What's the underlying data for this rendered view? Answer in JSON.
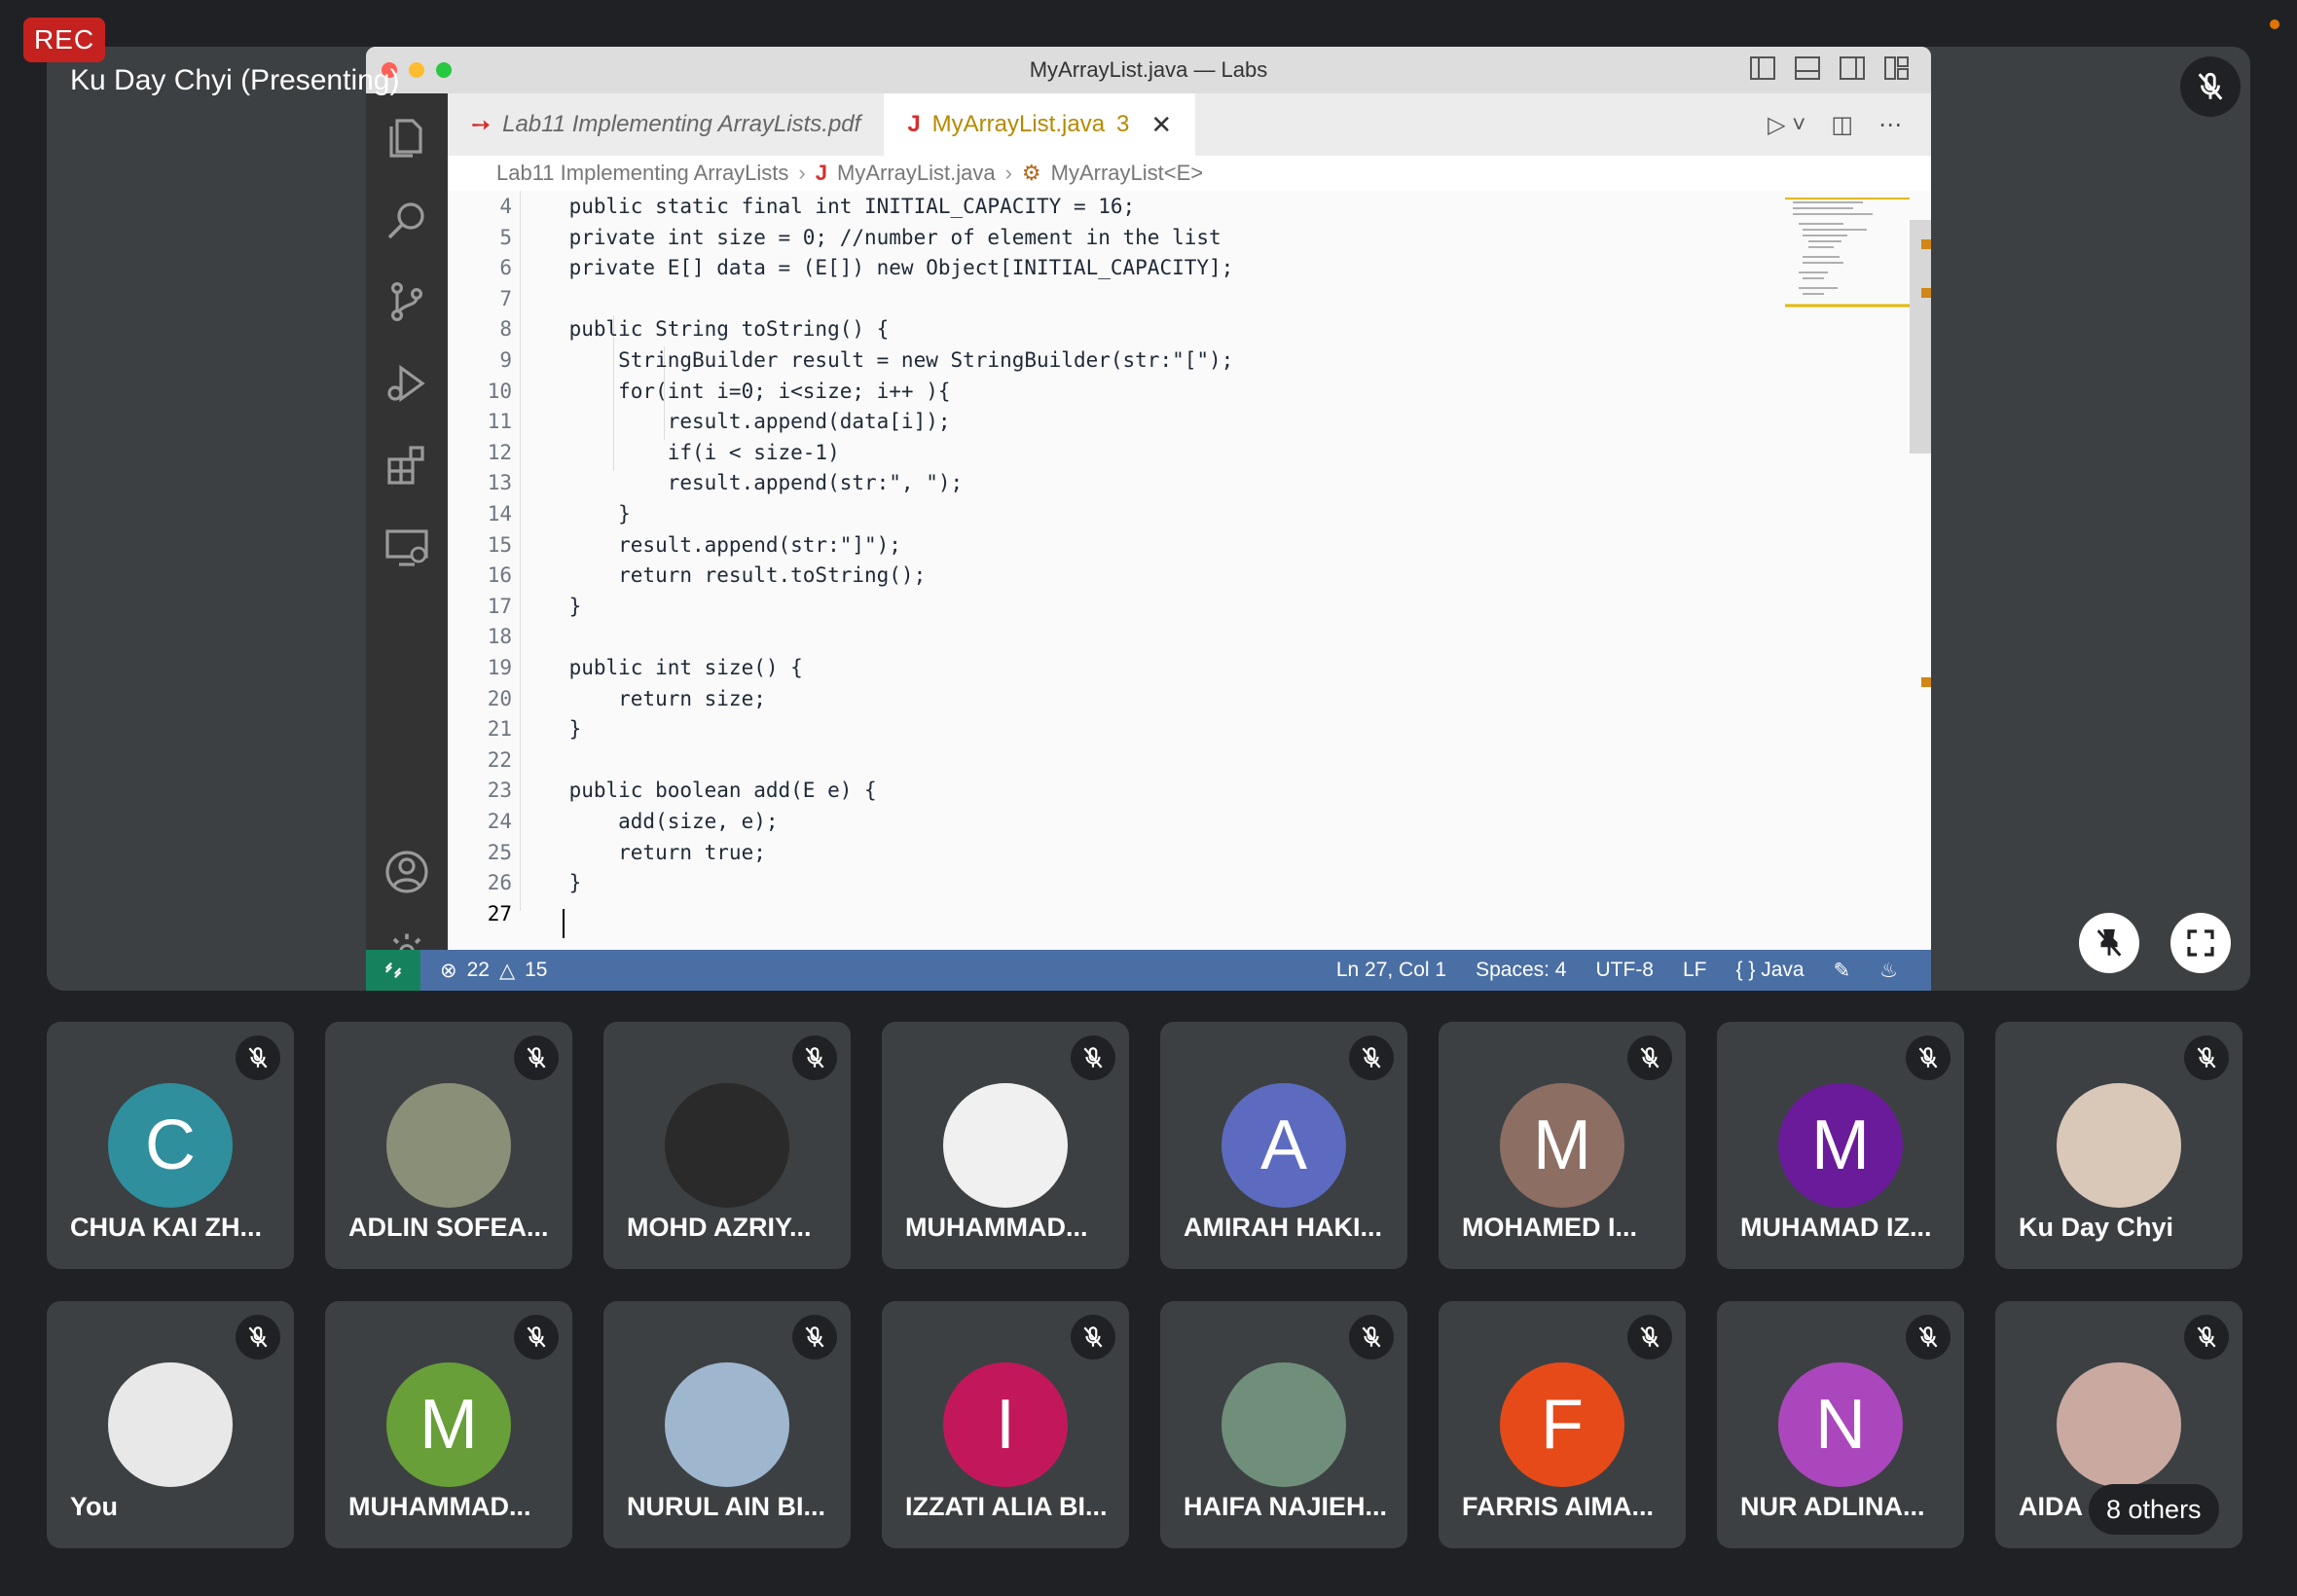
{
  "meeting": {
    "rec_label": "REC",
    "presenter_label": "Ku Day Chyi (Presenting)"
  },
  "vscode": {
    "window_title": "MyArrayList.java — Labs",
    "tabs": [
      {
        "label": "Lab11 Implementing ArrayLists.pdf",
        "icon": "pdf-icon"
      },
      {
        "label": "MyArrayList.java",
        "badge": "3",
        "icon": "java-icon"
      }
    ],
    "breadcrumbs": [
      "Lab11 Implementing ArrayLists",
      "MyArrayList.java",
      "MyArrayList<E>"
    ],
    "code_lines": [
      {
        "n": "4",
        "text": "    public static final int INITIAL_CAPACITY = 16;"
      },
      {
        "n": "5",
        "text": "    private int size = 0; //number of element in the list"
      },
      {
        "n": "6",
        "text": "    private E[] data = (E[]) new Object[INITIAL_CAPACITY];"
      },
      {
        "n": "7",
        "text": ""
      },
      {
        "n": "8",
        "text": "    public String toString() {"
      },
      {
        "n": "9",
        "text": "        StringBuilder result = new StringBuilder(str:\"[\");"
      },
      {
        "n": "10",
        "text": "        for(int i=0; i<size; i++ ){"
      },
      {
        "n": "11",
        "text": "            result.append(data[i]);"
      },
      {
        "n": "12",
        "text": "            if(i < size-1)"
      },
      {
        "n": "13",
        "text": "            result.append(str:\", \");"
      },
      {
        "n": "14",
        "text": "        }"
      },
      {
        "n": "15",
        "text": "        result.append(str:\"]\");"
      },
      {
        "n": "16",
        "text": "        return result.toString();"
      },
      {
        "n": "17",
        "text": "    }"
      },
      {
        "n": "18",
        "text": ""
      },
      {
        "n": "19",
        "text": "    public int size() {"
      },
      {
        "n": "20",
        "text": "        return size;"
      },
      {
        "n": "21",
        "text": "    }"
      },
      {
        "n": "22",
        "text": ""
      },
      {
        "n": "23",
        "text": "    public boolean add(E e) {"
      },
      {
        "n": "24",
        "text": "        add(size, e);"
      },
      {
        "n": "25",
        "text": "        return true;"
      },
      {
        "n": "26",
        "text": "    }"
      },
      {
        "n": "27",
        "text": ""
      }
    ],
    "status": {
      "errors": "22",
      "warnings": "15",
      "position": "Ln 27, Col 1",
      "spaces": "Spaces: 4",
      "encoding": "UTF-8",
      "eol": "LF",
      "language": "{ } Java"
    }
  },
  "participants": [
    {
      "name": "CHUA KAI ZH...",
      "initial": "C",
      "color": "#2f8f9d"
    },
    {
      "name": "ADLIN SOFEA...",
      "initial": "",
      "color": "#8a8f78"
    },
    {
      "name": "MOHD AZRIY...",
      "initial": "",
      "color": "#2a2a2a"
    },
    {
      "name": "MUHAMMAD...",
      "initial": "",
      "color": "#f0f0f0"
    },
    {
      "name": "AMIRAH HAKI...",
      "initial": "A",
      "color": "#5c6bc0"
    },
    {
      "name": "MOHAMED I...",
      "initial": "M",
      "color": "#8d6e63"
    },
    {
      "name": "MUHAMAD IZ...",
      "initial": "M",
      "color": "#6a1b9a"
    },
    {
      "name": "Ku Day Chyi",
      "initial": "",
      "color": "#d9c7b8"
    },
    {
      "name": "You",
      "initial": "",
      "color": "#e8e8e8"
    },
    {
      "name": "MUHAMMAD...",
      "initial": "M",
      "color": "#689f38"
    },
    {
      "name": "NURUL AIN BI...",
      "initial": "",
      "color": "#9fb6cf"
    },
    {
      "name": "IZZATI ALIA BI...",
      "initial": "I",
      "color": "#c2185b"
    },
    {
      "name": "HAIFA NAJIEH...",
      "initial": "",
      "color": "#6f8f7a"
    },
    {
      "name": "FARRIS AIMA...",
      "initial": "F",
      "color": "#e64a19"
    },
    {
      "name": "NUR ADLINA...",
      "initial": "N",
      "color": "#ab47bc"
    },
    {
      "name": "AIDA",
      "initial": "",
      "color": "#c9a9a0",
      "others": "8 others"
    }
  ]
}
